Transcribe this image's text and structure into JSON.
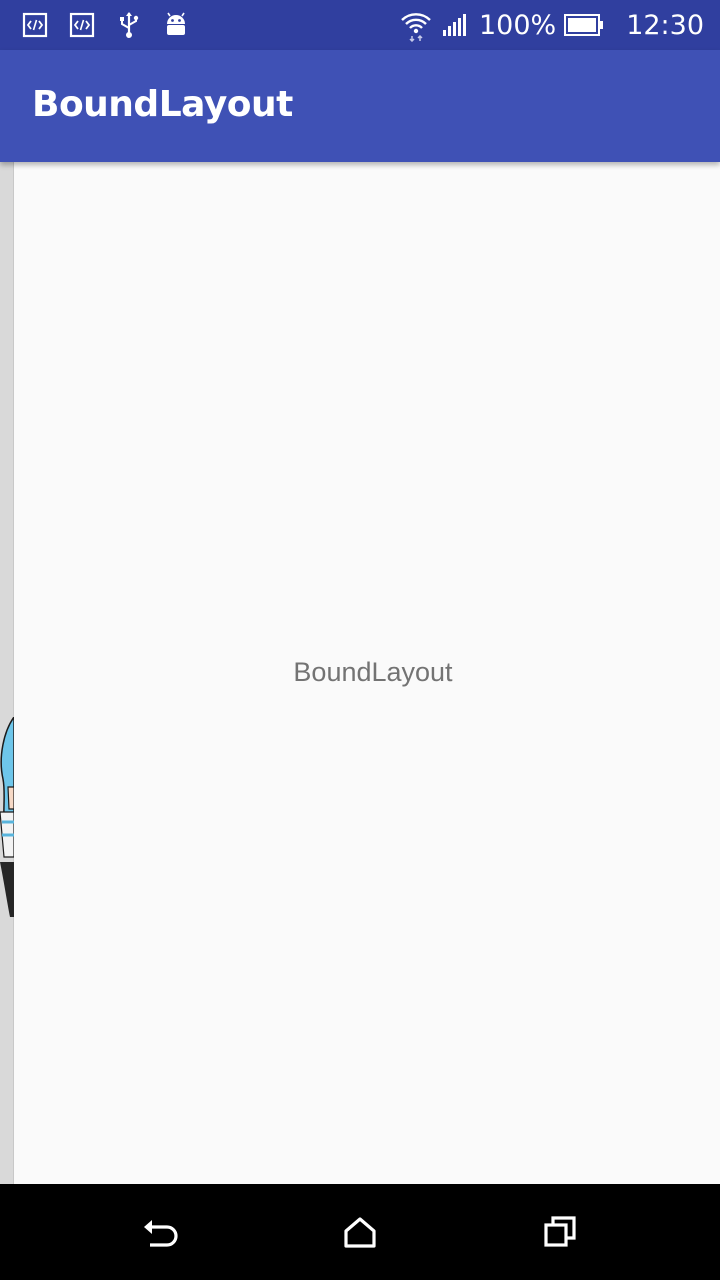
{
  "status_bar": {
    "left_icons": [
      "code-icon",
      "code-icon",
      "usb-icon",
      "android-icon"
    ],
    "right_icons": [
      "wifi-icon",
      "signal-icon",
      "battery-icon"
    ],
    "battery_percent": "100%",
    "time": "12:30"
  },
  "toolbar": {
    "title": "BoundLayout"
  },
  "main": {
    "center_text": "BoundLayout"
  },
  "nav_bar": {
    "buttons": [
      "back-icon",
      "home-icon",
      "recents-icon"
    ]
  },
  "colors": {
    "status_bar": "#303f9f",
    "toolbar": "#3f51b5",
    "background": "#fafafa",
    "text_secondary": "#737373"
  }
}
